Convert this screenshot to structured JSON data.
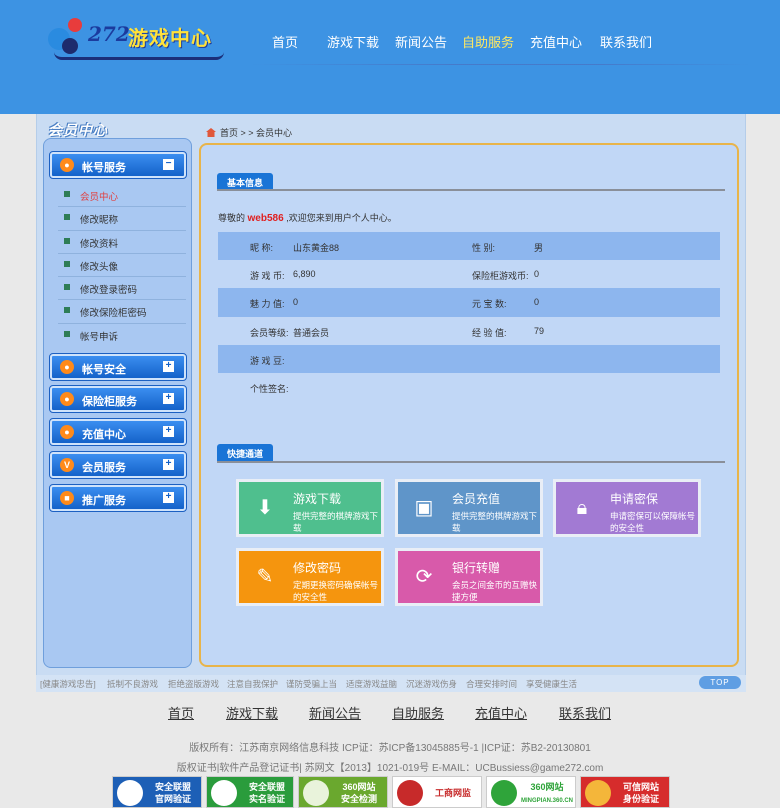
{
  "header": {
    "logo_number": "272",
    "logo_title": "游戏中心",
    "nav": [
      "首页",
      "游戏下载",
      "新闻公告",
      "自助服务",
      "充值中心",
      "联系我们"
    ],
    "active_nav": "自助服务",
    "colors": {
      "header_bg": "#3d93e3",
      "active": "#ffe860"
    }
  },
  "sidebar": {
    "title": "会员中心",
    "sections": [
      {
        "label": "帐号服务",
        "toggle": "−",
        "icon": "user-icon"
      },
      {
        "label": "帐号安全",
        "toggle": "+",
        "icon": "lock-icon"
      },
      {
        "label": "保险柜服务",
        "toggle": "+",
        "icon": "safe-icon"
      },
      {
        "label": "充值中心",
        "toggle": "+",
        "icon": "coin-icon"
      },
      {
        "label": "会员服务",
        "toggle": "+",
        "icon": "vip-icon"
      },
      {
        "label": "推广服务",
        "toggle": "+",
        "icon": "monitor-icon"
      }
    ],
    "sub_items": [
      "会员中心",
      "修改昵称",
      "修改资料",
      "修改头像",
      "修改登录密码",
      "修改保险柜密码",
      "帐号申诉"
    ],
    "current_sub": "会员中心"
  },
  "breadcrumb": {
    "home": "首页",
    "sep": " > > ",
    "current": "会员中心"
  },
  "basic": {
    "tab": "基本信息",
    "welcome_prefix": "尊敬的",
    "username": "web586",
    "welcome_suffix": ",欢迎您来到用户个人中心。",
    "rows": [
      {
        "k1": "昵      称:",
        "v1": "山东黄金88",
        "k2": "性      别:",
        "v2": "男"
      },
      {
        "k1": "游 戏 币:",
        "v1": "6,890",
        "k2": "保险柜游戏币:",
        "v2": "0"
      },
      {
        "k1": "魅 力 值:",
        "v1": "0",
        "k2": "元 宝 数:",
        "v2": "0"
      },
      {
        "k1": "会员等级:",
        "v1": "普通会员",
        "k2": "经 验 值:",
        "v2": "79"
      },
      {
        "k1": "游 戏 豆:",
        "v1": "",
        "k2": "",
        "v2": ""
      },
      {
        "k1": "个性签名:",
        "v1": "",
        "k2": "",
        "v2": ""
      }
    ]
  },
  "quick": {
    "tab": "快捷通道",
    "tiles": [
      {
        "title": "游戏下载",
        "desc": "提供完整的棋牌游戏下载",
        "color": "#4fbf8e",
        "icon": "download-icon"
      },
      {
        "title": "会员充值",
        "desc": "提供完整的棋牌游戏下载",
        "color": "#5f95c9",
        "icon": "wallet-icon"
      },
      {
        "title": "申请密保",
        "desc": "申请密保可以保障帐号的安全性",
        "color": "#a27ad3",
        "icon": "padlock-icon"
      },
      {
        "title": "修改密码",
        "desc": "定期更换密码确保帐号的安全性",
        "color": "#f5950e",
        "icon": "pencil-icon"
      },
      {
        "title": "银行转赠",
        "desc": "会员之间金币的互赠快捷方便",
        "color": "#d85aaa",
        "icon": "transfer-icon"
      }
    ]
  },
  "health_bar": [
    "[健康游戏忠告]",
    "抵制不良游戏",
    "拒绝盗版游戏",
    "注意自我保护",
    "谨防受骗上当",
    "适度游戏益脑",
    "沉迷游戏伤身",
    "合理安排时间",
    "享受健康生活"
  ],
  "top_label": "TOP",
  "footer": {
    "nav": [
      "首页",
      "游戏下载",
      "新闻公告",
      "自助服务",
      "充值中心",
      "联系我们"
    ],
    "copyright": "版权所有：江苏南京网络信息科技    ICP证：苏ICP备13045885号-1 |ICP证：苏B2-20130801",
    "license": "版权证书|软件产品登记证书| 苏网文【2013】1021-019号    E-MAIL：UCBussiess@game272.com",
    "badges": [
      {
        "line1": "安全联盟",
        "line2": "官网验证",
        "color": "#1d5fb6"
      },
      {
        "line1": "安全联盟",
        "line2": "实名验证",
        "color": "#2a9c3c"
      },
      {
        "line1": "360网站",
        "line2": "安全检测",
        "color": "#6aa82e"
      },
      {
        "line1": "工商网监",
        "line2": "",
        "color": "#c72a2a"
      },
      {
        "line1": "360网站",
        "line2": "MINGPIAN.360.CN",
        "color": "#2fa43a"
      },
      {
        "line1": "可信网站",
        "line2": "身份验证",
        "color": "#d62c2c"
      }
    ]
  }
}
